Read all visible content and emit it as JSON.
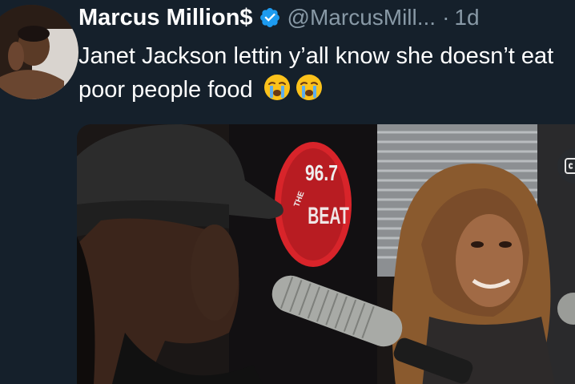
{
  "tweet": {
    "author_name": "Marcus Million$",
    "handle": "@MarcusMill...",
    "separator": "·",
    "time": "1d",
    "text": "Janet Jackson lettin y’all know she doesn’t eat poor people food",
    "emojis": [
      "loudly-crying-face",
      "loudly-crying-face"
    ]
  },
  "media": {
    "station_logo_number": "96.7",
    "station_logo_word": "BEAT",
    "station_logo_small": "THE",
    "caption_button": "cc-icon"
  },
  "icons": {
    "verified": "verified-badge-icon",
    "captions": "closed-captions-icon"
  },
  "colors": {
    "background": "#15202b",
    "secondary_text": "#8899a6",
    "verified_blue": "#1d9bf0",
    "logo_red": "#d8242a"
  }
}
